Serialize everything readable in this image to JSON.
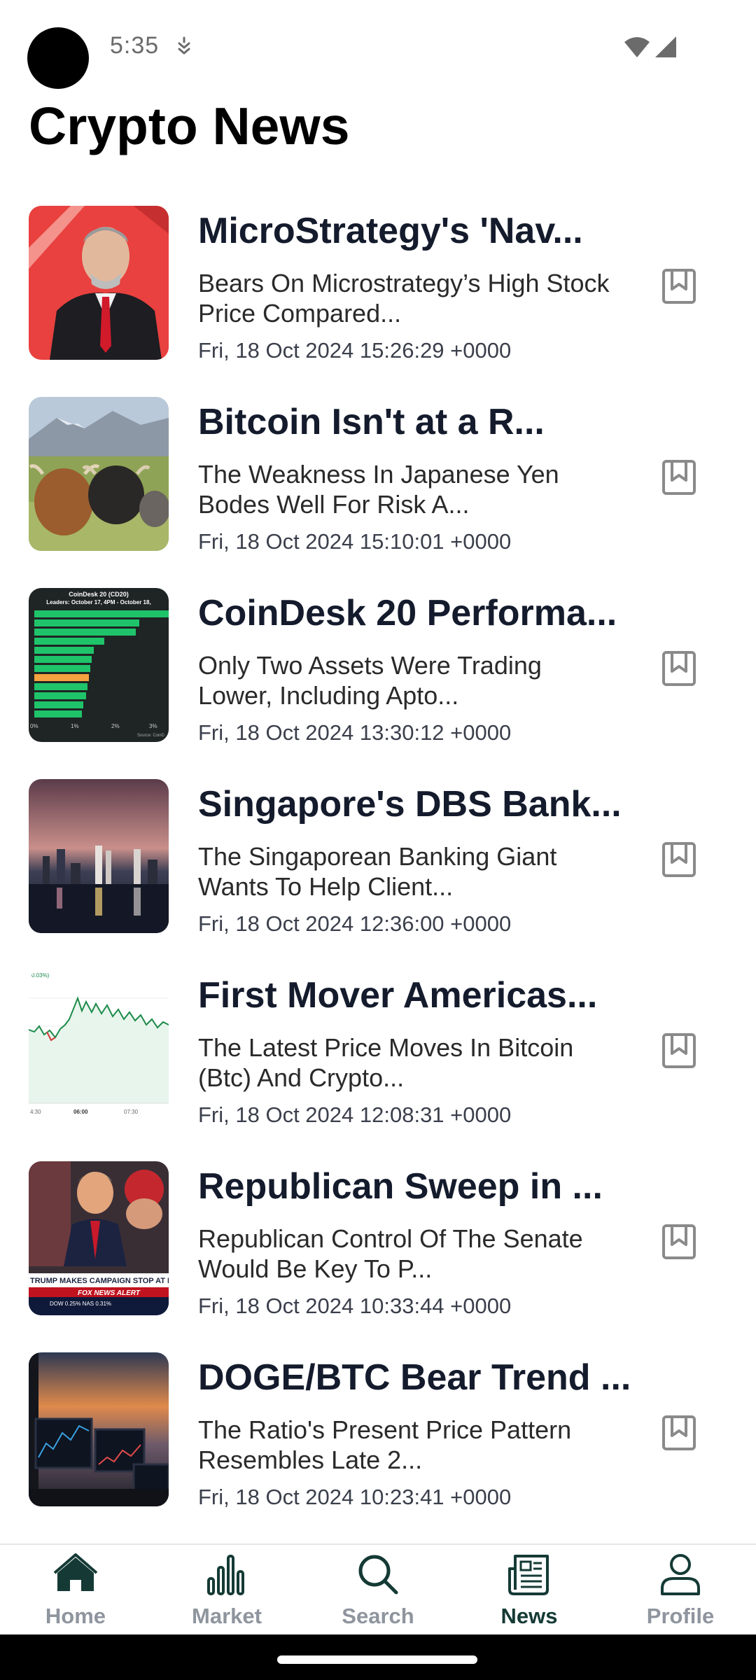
{
  "status_bar": {
    "time": "5:35"
  },
  "header": {
    "title": "Crypto News"
  },
  "news": [
    {
      "title": "MicroStrategy's 'Nav...",
      "description": "Bears On Microstrategy’s High Stock Price Compared...",
      "date": "Fri, 18 Oct 2024 15:26:29 +0000",
      "thumbnail": "portrait-man-red-background"
    },
    {
      "title": "Bitcoin Isn't at a R...",
      "description": "The Weakness In Japanese Yen Bodes Well For Risk A...",
      "date": "Fri, 18 Oct 2024 15:10:01 +0000",
      "thumbnail": "highland-cattle-field"
    },
    {
      "title": "CoinDesk 20 Performa...",
      "description": "Only Two Assets Were Trading Lower, Including Apto...",
      "date": "Fri, 18 Oct 2024 13:30:12 +0000",
      "thumbnail": "coindesk-bar-chart",
      "thumbnail_text": {
        "title": "CoinDesk 20 (CD20)",
        "subtitle": "Leaders: October 17, 4PM - October 18,",
        "ticks": [
          "0%",
          "1%",
          "2%",
          "3%"
        ],
        "source": "Source: CoinD"
      }
    },
    {
      "title": "Singapore's DBS Bank...",
      "description": "The Singaporean Banking Giant Wants To Help Client...",
      "date": "Fri, 18 Oct 2024 12:36:00 +0000",
      "thumbnail": "city-skyline-night"
    },
    {
      "title": "First Mover Americas...",
      "description": "The Latest Price Moves In Bitcoin (Btc) And Crypto...",
      "date": "Fri, 18 Oct 2024 12:08:31 +0000",
      "thumbnail": "price-line-chart",
      "thumbnail_text": {
        "change": "0.03%)",
        "ticks": [
          "4:30",
          "06:00",
          "07:30"
        ]
      }
    },
    {
      "title": "Republican Sweep in ...",
      "description": "Republican Control Of The Senate Would Be Key To P...",
      "date": "Fri, 18 Oct 2024 10:33:44 +0000",
      "thumbnail": "news-broadcast",
      "thumbnail_text": {
        "banner": "TRUMP MAKES CAMPAIGN STOP AT NYC",
        "alert": "FOX NEWS ALERT",
        "ticker": "DOW 0.25% NAS 0.31%"
      }
    },
    {
      "title": "DOGE/BTC Bear Trend ...",
      "description": "The Ratio's Present Price Pattern Resembles Late 2...",
      "date": "Fri, 18 Oct 2024 10:23:41 +0000",
      "thumbnail": "trading-monitors-sunset"
    }
  ],
  "bottom_nav": {
    "items": [
      {
        "label": "Home",
        "icon": "home-icon"
      },
      {
        "label": "Market",
        "icon": "chart-bars-icon"
      },
      {
        "label": "Search",
        "icon": "search-icon"
      },
      {
        "label": "News",
        "icon": "newspaper-icon",
        "active": true
      },
      {
        "label": "Profile",
        "icon": "person-icon"
      }
    ]
  },
  "colors": {
    "title_text": "#141b2c",
    "active_nav": "#153a35",
    "inactive_nav": "#8f959e"
  }
}
